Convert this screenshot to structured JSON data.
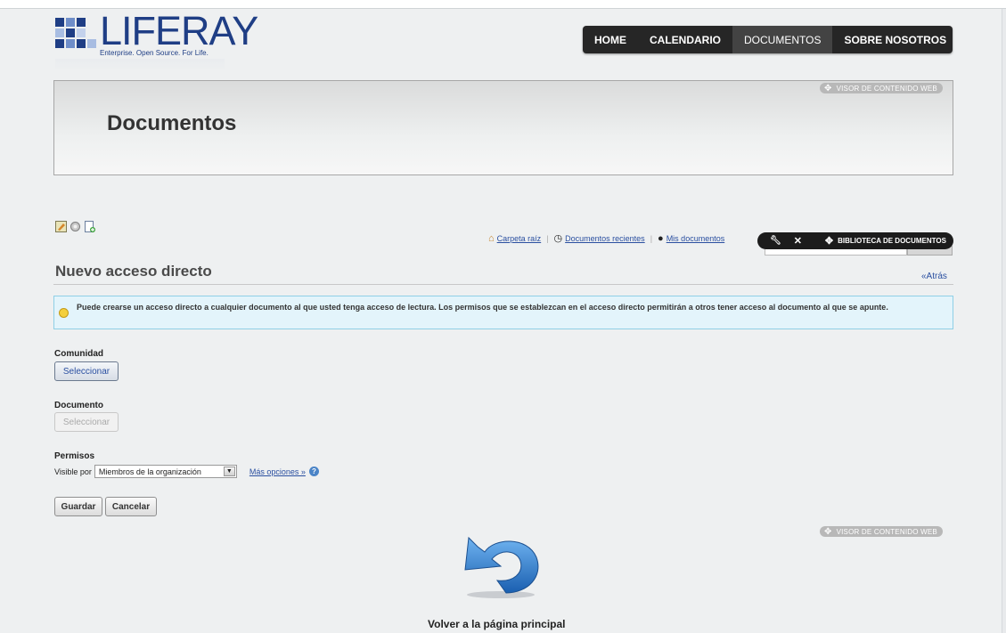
{
  "logo": {
    "name": "LIFERAY",
    "tagline": "Enterprise. Open Source. For Life."
  },
  "nav": {
    "items": [
      {
        "label": "HOME"
      },
      {
        "label": "CALENDARIO"
      },
      {
        "label": "DOCUMENTOS",
        "selected": true
      },
      {
        "label": "SOBRE NOSOTROS"
      }
    ]
  },
  "header": {
    "title": "Documentos",
    "portlet_label": "VISOR DE CONTENIDO WEB"
  },
  "links": {
    "root": "Carpeta raíz",
    "recent": "Documentos recientes",
    "mine": "Mis documentos"
  },
  "library_bar": {
    "title": "BIBLIOTECA DE DOCUMENTOS"
  },
  "form": {
    "title": "Nuevo acceso directo",
    "back": "«Atrás",
    "info": "Puede crearse un acceso directo a cualquier documento al que usted tenga acceso de lectura. Los permisos que se establezcan en el acceso directo permitirán a otros tener acceso al documento al que se apunte.",
    "community_label": "Comunidad",
    "community_button": "Seleccionar",
    "document_label": "Documento",
    "document_button": "Seleccionar",
    "permissions_label": "Permisos",
    "visible_label": "Visible por",
    "visible_value": "Miembros de la organización",
    "more_options": "Más opciones »",
    "save": "Guardar",
    "cancel": "Cancelar"
  },
  "footer_portlet_label": "VISOR DE CONTENIDO WEB",
  "home_link": "Volver a la página principal",
  "colors": {
    "nav_bg": "#262626",
    "link": "#2a4fa0",
    "info_bg": "#e3f4fb",
    "info_border": "#8fcfe6",
    "brand": "#1f3e85"
  }
}
